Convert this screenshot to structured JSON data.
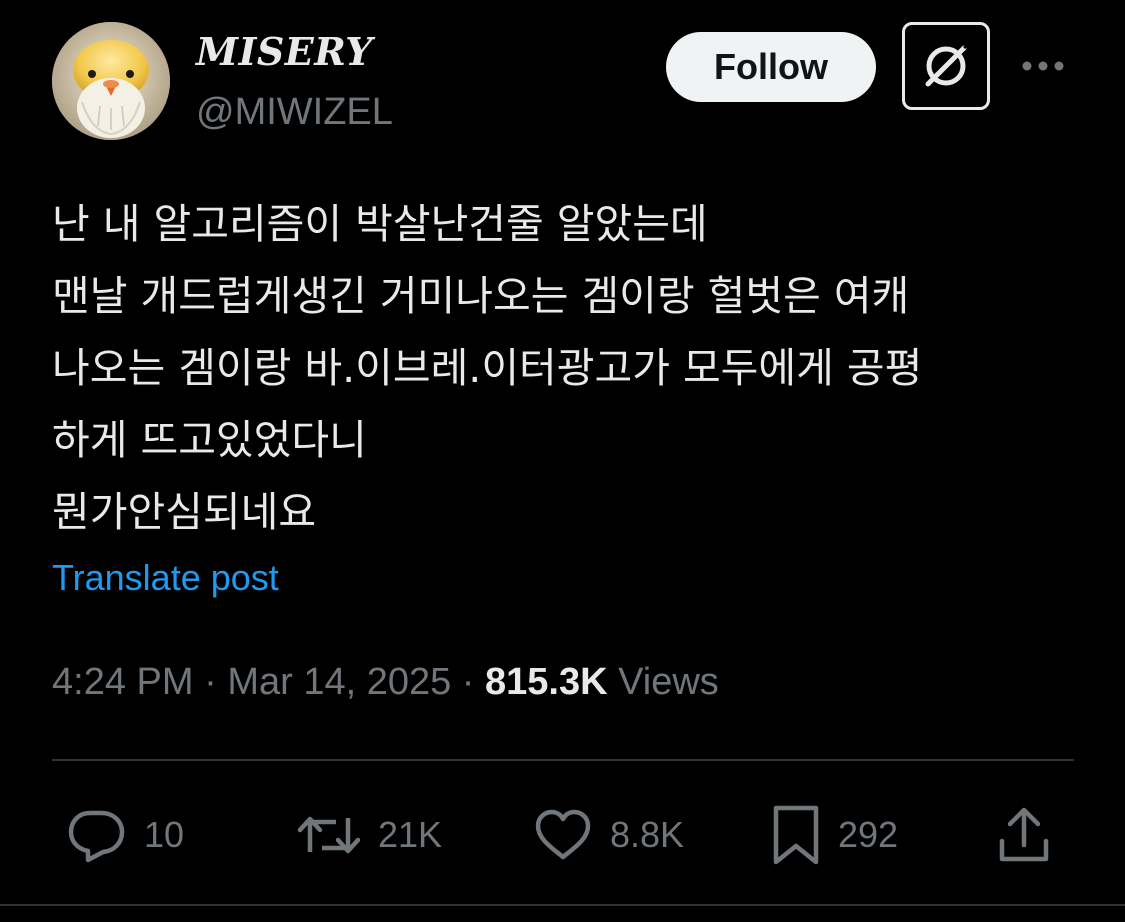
{
  "author": {
    "display_name": "MISERY",
    "handle": "@MIWIZEL",
    "avatar_icon": "bird-avatar"
  },
  "header": {
    "follow_label": "Follow",
    "grok_icon": "grok-icon",
    "more_icon": "more-dots-icon"
  },
  "tweet": {
    "lines": [
      "난 내 알고리즘이 박살난건줄 알았는데",
      "맨날 개드럽게생긴 거미나오는 겜이랑 헐벗은 여캐",
      "나오는 겜이랑 바.이브레.이터광고가 모두에게 공평",
      "하게 뜨고있었다니",
      "뭔가안심되네요"
    ],
    "translate_label": "Translate post"
  },
  "meta": {
    "time": "4:24 PM",
    "separator": "·",
    "date": "Mar 14, 2025",
    "views_count": "815.3K",
    "views_label": "Views"
  },
  "actions": {
    "replies": "10",
    "reposts": "21K",
    "likes": "8.8K",
    "bookmarks": "292"
  },
  "colors": {
    "background": "#000000",
    "text_primary": "#e7e9ea",
    "text_secondary": "#71767b",
    "link": "#1d9bf0",
    "divider": "#2f3336"
  }
}
